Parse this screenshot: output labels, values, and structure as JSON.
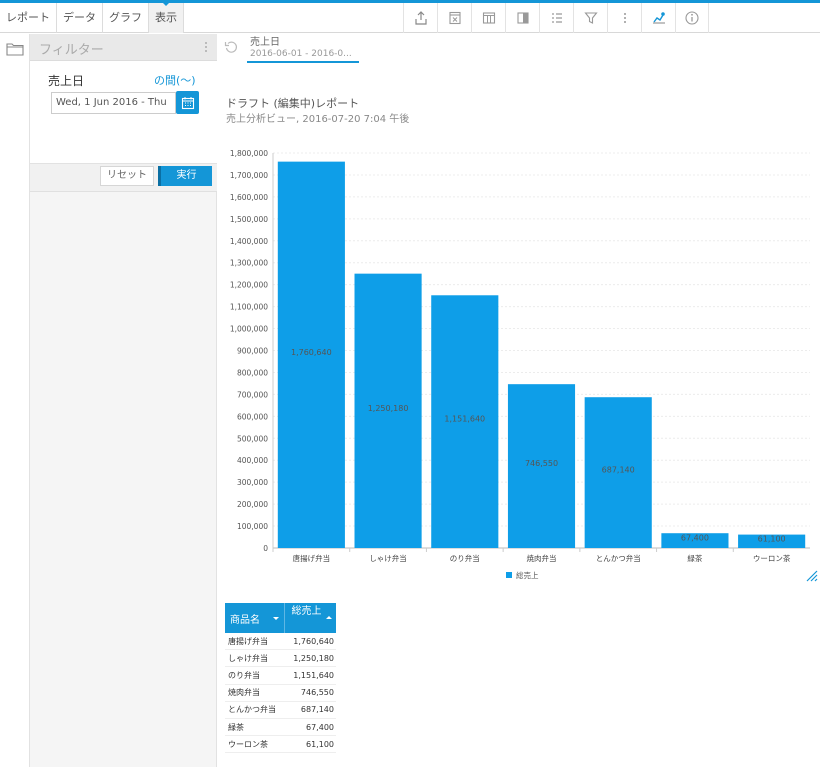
{
  "toolbar": {
    "tabs": [
      "レポート",
      "データ",
      "グラフ",
      "表示"
    ],
    "active_tab": "表示",
    "icons": [
      "export-icon",
      "excel-icon",
      "table-icon",
      "columns-icon",
      "list-icon",
      "filter-icon",
      "more-icon",
      "chart-icon",
      "info-icon"
    ]
  },
  "filter_panel": {
    "title": "フィルター",
    "field_label": "売上日",
    "operator": "の間(〜)",
    "date_value": "Wed, 1 Jun 2016 - Thu",
    "reset_label": "リセット",
    "run_label": "実行"
  },
  "summary": {
    "field": "売上日",
    "range": "2016-06-01 - 2016-0..."
  },
  "report": {
    "title": "ドラフト (編集中)レポート",
    "subtitle": "売上分析ビュー, 2016-07-20 7:04 午後"
  },
  "colors": {
    "accent": "#1496d7",
    "bar": "#0e9ee8"
  },
  "chart_data": {
    "type": "bar",
    "categories": [
      "唐揚げ弁当",
      "しゃけ弁当",
      "のり弁当",
      "焼肉弁当",
      "とんかつ弁当",
      "緑茶",
      "ウーロン茶"
    ],
    "series": [
      {
        "name": "総売上",
        "values": [
          1760640,
          1250180,
          1151640,
          746550,
          687140,
          67400,
          61100
        ]
      }
    ],
    "data_labels": [
      "1,760,640",
      "1,250,180",
      "1,151,640",
      "746,550",
      "687,140",
      "67,400",
      "61,100"
    ],
    "ylim": [
      0,
      1800000
    ],
    "yticks": [
      "0",
      "100,000",
      "200,000",
      "300,000",
      "400,000",
      "500,000",
      "600,000",
      "700,000",
      "800,000",
      "900,000",
      "1,000,000",
      "1,100,000",
      "1,200,000",
      "1,300,000",
      "1,400,000",
      "1,500,000",
      "1,600,000",
      "1,700,000",
      "1,800,000"
    ],
    "legend": "bottom",
    "grid": true
  },
  "table": {
    "headers": [
      "商品名",
      "総売上"
    ],
    "rows": [
      [
        "唐揚げ弁当",
        "1,760,640"
      ],
      [
        "しゃけ弁当",
        "1,250,180"
      ],
      [
        "のり弁当",
        "1,151,640"
      ],
      [
        "焼肉弁当",
        "746,550"
      ],
      [
        "とんかつ弁当",
        "687,140"
      ],
      [
        "緑茶",
        "67,400"
      ],
      [
        "ウーロン茶",
        "61,100"
      ]
    ]
  }
}
